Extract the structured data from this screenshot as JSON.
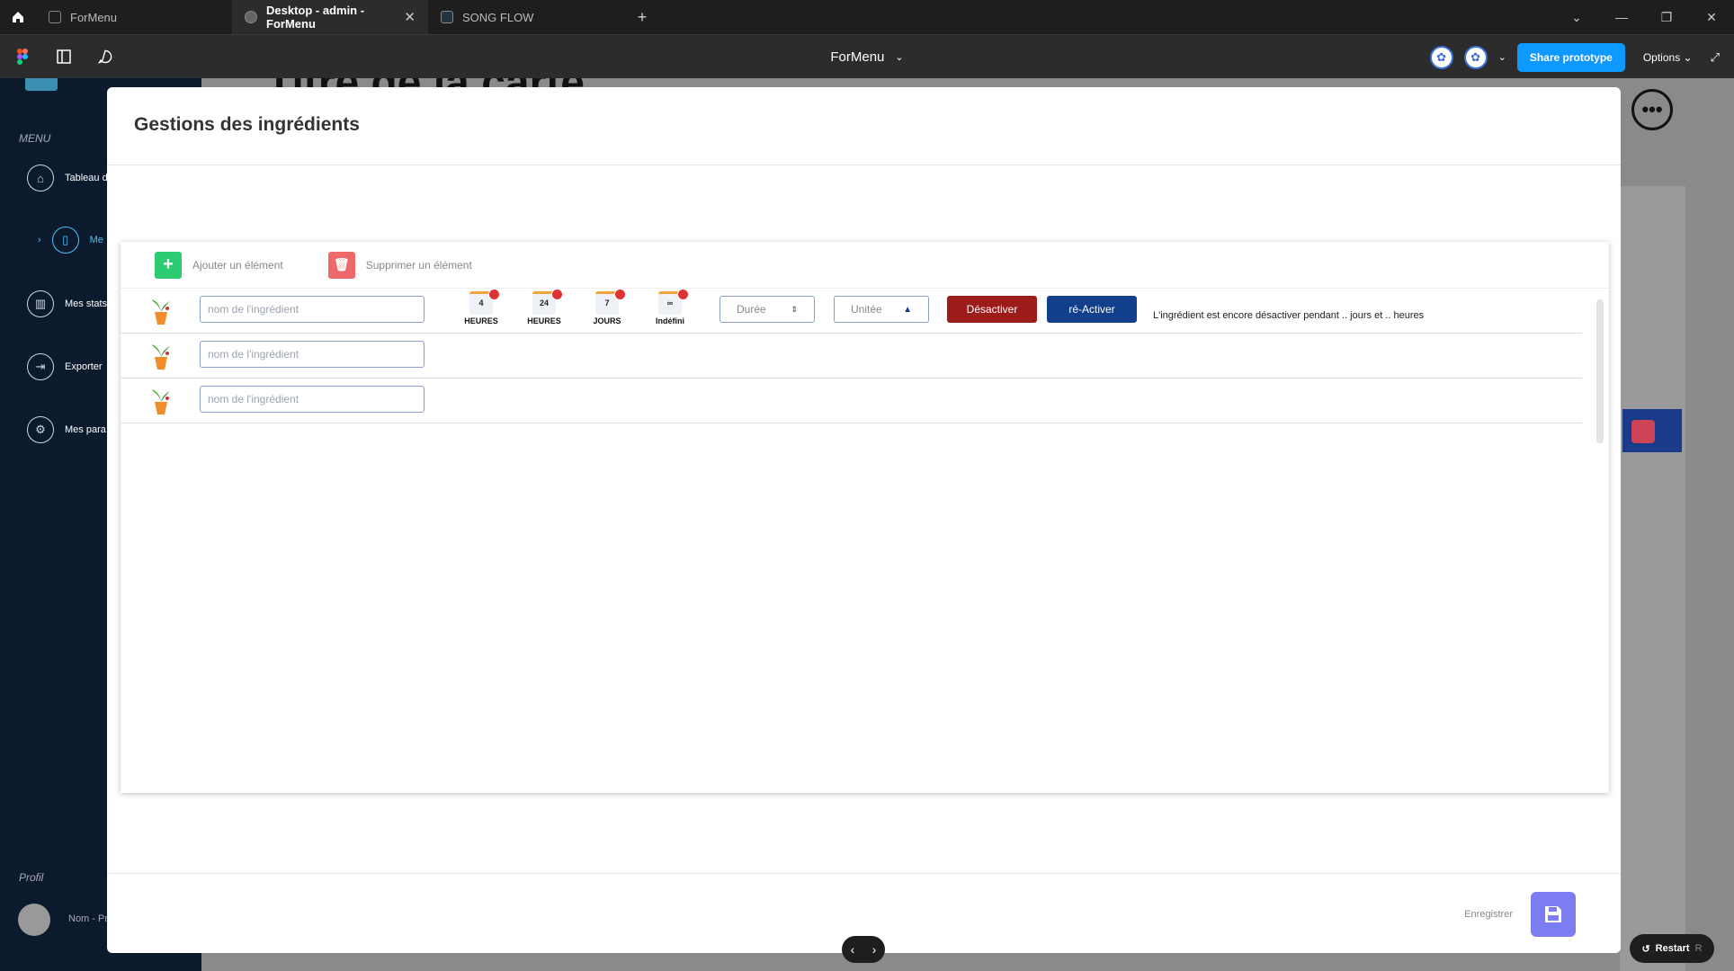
{
  "browser": {
    "tabs": [
      {
        "label": "ForMenu",
        "active": false
      },
      {
        "label": "Desktop - admin - ForMenu",
        "active": true
      },
      {
        "label": "SONG FLOW",
        "active": false
      }
    ]
  },
  "toolbar": {
    "doc_title": "ForMenu",
    "share_label": "Share prototype",
    "options_label": "Options"
  },
  "sidebar": {
    "section": "MENU",
    "items": [
      {
        "label": "Tableau d"
      },
      {
        "label": "Me"
      },
      {
        "label": "Mes stats"
      },
      {
        "label": "Exporter"
      },
      {
        "label": "Mes para"
      }
    ],
    "profile_title": "Profil",
    "profile_name": "Nom - Pr"
  },
  "background": {
    "title": "Titre de la carte"
  },
  "modal": {
    "title": "Gestions des ingrédients",
    "add_label": "Ajouter un élément",
    "delete_label": "Supprimer un élément",
    "input_placeholder": "nom de l'ingrédient",
    "durations": [
      {
        "value": "4",
        "unit": "HEURES"
      },
      {
        "value": "24",
        "unit": "HEURES"
      },
      {
        "value": "7",
        "unit": "JOURS"
      },
      {
        "value": "∞",
        "unit": "Indéfini"
      }
    ],
    "duration_select": "Durée",
    "unit_select": "Unitée",
    "deactivate_label": "Désactiver",
    "reactivate_label": "ré-Activer",
    "info_text": "L'ingrédient est encore désactiver pendant .. jours et .. heures",
    "save_label": "Enregistrer"
  },
  "restart": {
    "label": "Restart",
    "key": "R"
  },
  "colors": {
    "accent": "#0d99ff",
    "deactivate": "#9e1b1b",
    "reactivate": "#123f8c",
    "add": "#2ecc71",
    "delete": "#ee6a6a",
    "save": "#7b7df0"
  }
}
